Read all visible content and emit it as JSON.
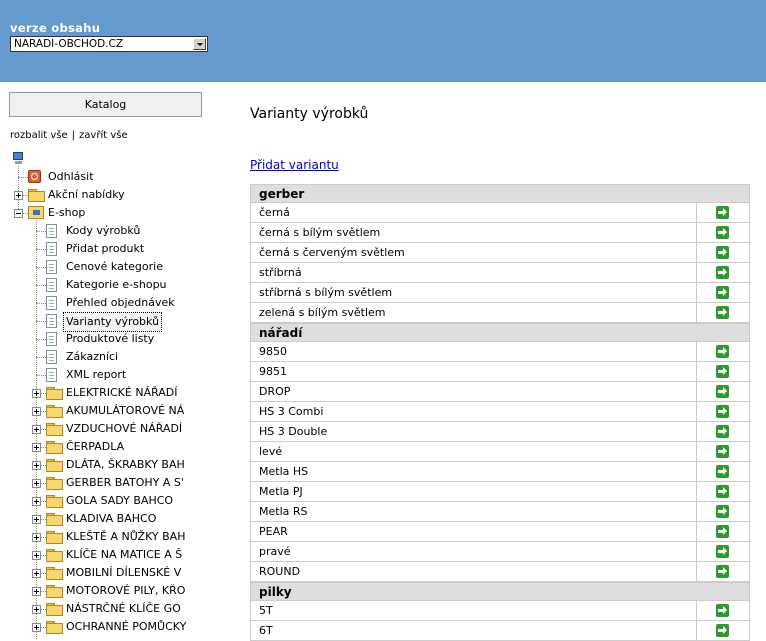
{
  "header": {
    "version_label": "verze obsahu",
    "version_select_value": "NARADI-OBCHOD.CZ",
    "background_color": "#6699cc"
  },
  "sidebar": {
    "katalog_button": "Katalog",
    "expand_all": "rozbalit vše",
    "separator": "|",
    "collapse_all": "zavřít vše",
    "tree": [
      {
        "label": "Odhlásit",
        "icon": "logout-icon",
        "level": 1
      },
      {
        "label": "Akční nabídky",
        "icon": "folder-icon",
        "level": 1,
        "expander": "closed"
      },
      {
        "label": "E-shop",
        "icon": "eshop-icon",
        "level": 1,
        "expander": "open"
      },
      {
        "label": "Kody výrobků",
        "icon": "document-icon",
        "level": 2
      },
      {
        "label": "Přidat produkt",
        "icon": "document-icon",
        "level": 2
      },
      {
        "label": "Cenové kategorie",
        "icon": "document-icon",
        "level": 2
      },
      {
        "label": "Kategorie e-shopu",
        "icon": "document-icon",
        "level": 2
      },
      {
        "label": "Přehled objednávek",
        "icon": "document-icon",
        "level": 2
      },
      {
        "label": "Varianty výrobků",
        "icon": "document-icon",
        "level": 2,
        "selected": true
      },
      {
        "label": "Produktové listy",
        "icon": "document-icon",
        "level": 2
      },
      {
        "label": "Zákazníci",
        "icon": "document-icon",
        "level": 2
      },
      {
        "label": "XML report",
        "icon": "document-icon",
        "level": 2
      },
      {
        "label": "ELEKTRICKÉ NÁŘADÍ",
        "icon": "folder-icon",
        "level": 2,
        "expander": "closed"
      },
      {
        "label": "AKUMULÁTOROVÉ NÁ",
        "icon": "folder-icon",
        "level": 2,
        "expander": "closed"
      },
      {
        "label": "VZDUCHOVÉ NÁŘADÍ",
        "icon": "folder-icon",
        "level": 2,
        "expander": "closed"
      },
      {
        "label": "ČERPADLA",
        "icon": "folder-icon",
        "level": 2,
        "expander": "closed"
      },
      {
        "label": "DLÁTA, ŠKRABKY BAH",
        "icon": "folder-icon",
        "level": 2,
        "expander": "closed"
      },
      {
        "label": "GERBER BATOHY A S'",
        "icon": "folder-icon",
        "level": 2,
        "expander": "closed"
      },
      {
        "label": "GOLA SADY BAHCO",
        "icon": "folder-icon",
        "level": 2,
        "expander": "closed"
      },
      {
        "label": "KLADIVA BAHCO",
        "icon": "folder-icon",
        "level": 2,
        "expander": "closed"
      },
      {
        "label": "KLEŠTĚ A NŮŽKY BAH",
        "icon": "folder-icon",
        "level": 2,
        "expander": "closed"
      },
      {
        "label": "KLÍČE NA MATICE A Š",
        "icon": "folder-icon",
        "level": 2,
        "expander": "closed"
      },
      {
        "label": "MOBILNÍ DÍLENSKÉ V",
        "icon": "folder-icon",
        "level": 2,
        "expander": "closed"
      },
      {
        "label": "MOTOROVÉ PILY, KŘO",
        "icon": "folder-icon",
        "level": 2,
        "expander": "closed"
      },
      {
        "label": "NÁSTRČNÉ KLÍČE GO",
        "icon": "folder-icon",
        "level": 2,
        "expander": "closed"
      },
      {
        "label": "OCHRANNÉ POMŮCKY",
        "icon": "folder-icon",
        "level": 2,
        "expander": "closed"
      }
    ]
  },
  "main": {
    "title": "Varianty výrobků",
    "add_link": "Přidat variantu",
    "groups": [
      {
        "name": "gerber",
        "rows": [
          "černá",
          "černá s bílým světlem",
          "černá s červeným světlem",
          "stříbrná",
          "stříbrná s bílým světlem",
          "zelená s bílým světlem"
        ]
      },
      {
        "name": "nářadí",
        "rows": [
          "9850",
          "9851",
          "DROP",
          "HS 3 Combi",
          "HS 3 Double",
          "levé",
          "Metla HS",
          "Metla PJ",
          "Metla RS",
          "PEAR",
          "pravé",
          "ROUND"
        ]
      },
      {
        "name": "pilky",
        "rows": [
          "5T",
          "6T"
        ]
      }
    ],
    "action_icon": "green-arrow-icon"
  }
}
